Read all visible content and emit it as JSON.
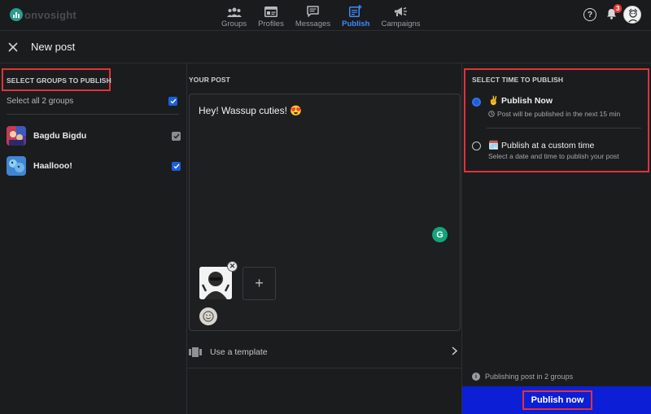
{
  "app": {
    "logo_text": "onvosight"
  },
  "nav": {
    "items": [
      {
        "label": "Groups",
        "icon": "groups-icon"
      },
      {
        "label": "Profiles",
        "icon": "profiles-icon"
      },
      {
        "label": "Messages",
        "icon": "messages-icon"
      },
      {
        "label": "Publish",
        "icon": "publish-icon",
        "active": true
      },
      {
        "label": "Campaigns",
        "icon": "campaigns-icon"
      }
    ],
    "help_label": "?",
    "notification_count": "3"
  },
  "page": {
    "title": "New post"
  },
  "groups": {
    "section_title": "SELECT GROUPS TO PUBLISH",
    "select_all_label": "Select all 2 groups",
    "items": [
      {
        "name": "Bagdu Bigdu",
        "checked": true
      },
      {
        "name": "Haallooo!",
        "checked": true
      }
    ]
  },
  "post": {
    "section_title": "YOUR POST",
    "text": "Hey! Wassup cuties! 😍",
    "add_media_label": "+",
    "template_label": "Use a template"
  },
  "schedule": {
    "section_title": "SELECT TIME TO PUBLISH",
    "options": [
      {
        "icon": "✌️",
        "title": "Publish Now",
        "subtitle": "Post will be published in the next 15 min",
        "selected": true
      },
      {
        "icon": "🗓️",
        "title": "Publish at a custom time",
        "subtitle": "Select a date and time to publish your post",
        "selected": false
      }
    ],
    "info_text": "Publishing post in 2 groups",
    "publish_button_label": "Publish now"
  },
  "colors": {
    "accent": "#1a5fe0",
    "highlight": "#e0333a",
    "publish_bar": "#0c1fd6"
  }
}
